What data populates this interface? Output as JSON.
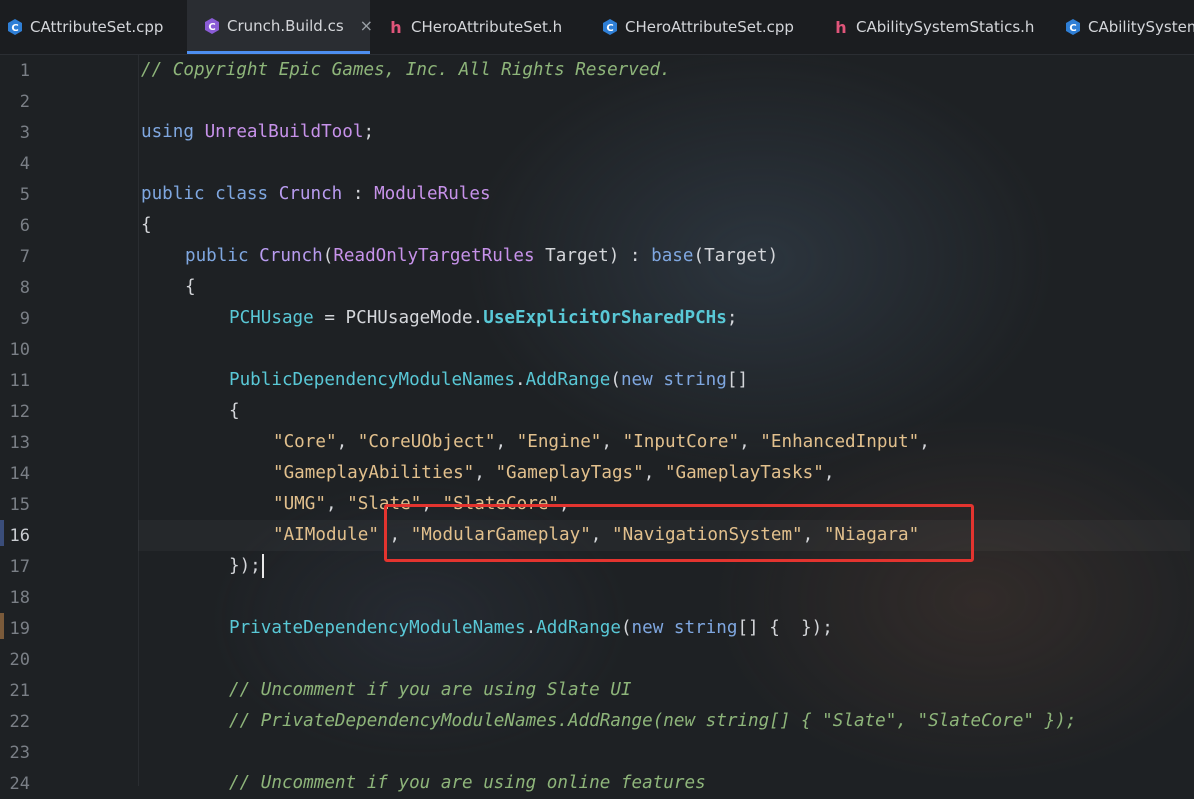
{
  "tabs": [
    {
      "label": "CAttributeSet.cpp",
      "icon": "csharp-file-icon"
    },
    {
      "label": "Crunch.Build.cs",
      "icon": "csharp-file-icon",
      "active": true
    },
    {
      "label": "CHeroAttributeSet.h",
      "icon": "header-file-icon"
    },
    {
      "label": "CHeroAttributeSet.cpp",
      "icon": "csharp-file-icon"
    },
    {
      "label": "CAbilitySystemStatics.h",
      "icon": "header-file-icon"
    },
    {
      "label": "CAbilitySystemS",
      "icon": "csharp-file-icon"
    }
  ],
  "close_glyph": "×",
  "editor": {
    "current_line": 16,
    "line_numbers": [
      "1",
      "2",
      "3",
      "4",
      "5",
      "6",
      "7",
      "8",
      "9",
      "10",
      "11",
      "12",
      "13",
      "14",
      "15",
      "16",
      "17",
      "18",
      "19",
      "20",
      "21",
      "22",
      "23",
      "24"
    ],
    "lines": {
      "l1": {
        "comment": "// Copyright Epic Games, Inc. All Rights Reserved."
      },
      "l3": {
        "kw": "using",
        "ns": "UnrealBuildTool",
        "end": ";"
      },
      "l5": {
        "kw1": "public",
        "kw2": "class",
        "name": "Crunch",
        "colon": " : ",
        "base": "ModuleRules"
      },
      "l6": {
        "text": "{"
      },
      "l7": {
        "kw": "public",
        "name": "Crunch",
        "p1": "(",
        "ptype": "ReadOnlyTargetRules",
        "pname": " Target) : ",
        "base": "base",
        "tail": "(Target)"
      },
      "l8": {
        "text": "{"
      },
      "l9": {
        "prop": "PCHUsage",
        "eq": " = ",
        "enumType": "PCHUsageMode",
        "dot": ".",
        "enumVal": "UseExplicitOrSharedPCHs",
        "end": ";"
      },
      "l11": {
        "obj": "PublicDependencyModuleNames",
        "dot": ".",
        "method": "AddRange",
        "p1": "(",
        "kw": "new",
        "type": "string",
        "tail": "[]"
      },
      "l12": {
        "text": "{"
      },
      "l13": {
        "s1": "\"Core\"",
        "s2": "\"CoreUObject\"",
        "s3": "\"Engine\"",
        "s4": "\"InputCore\"",
        "s5": "\"EnhancedInput\""
      },
      "l14": {
        "s1": "\"GameplayAbilities\"",
        "s2": "\"GameplayTags\"",
        "s3": "\"GameplayTasks\""
      },
      "l15": {
        "s1": "\"UMG\"",
        "s2": "\"Slate\"",
        "s3": "\"SlateCore\""
      },
      "l16": {
        "s1": "\"AIModule\"",
        "s2": "\"ModularGameplay\"",
        "s3": "\"NavigationSystem\"",
        "s4": "\"Niagara\""
      },
      "l17": {
        "text": "});"
      },
      "l19": {
        "obj": "PrivateDependencyModuleNames",
        "dot": ".",
        "method": "AddRange",
        "p1": "(",
        "kw": "new",
        "type": "string",
        "tail": "[] {  });"
      },
      "l21": {
        "comment": "// Uncomment if you are using Slate UI"
      },
      "l22": {
        "comment": "// PrivateDependencyModuleNames.AddRange(new string[] { \"Slate\", \"SlateCore\" });"
      },
      "l24": {
        "comment": "// Uncomment if you are using online features"
      }
    }
  },
  "colors": {
    "annotation_box": "#e3342f",
    "active_tab_underline": "#4d8ef0"
  }
}
